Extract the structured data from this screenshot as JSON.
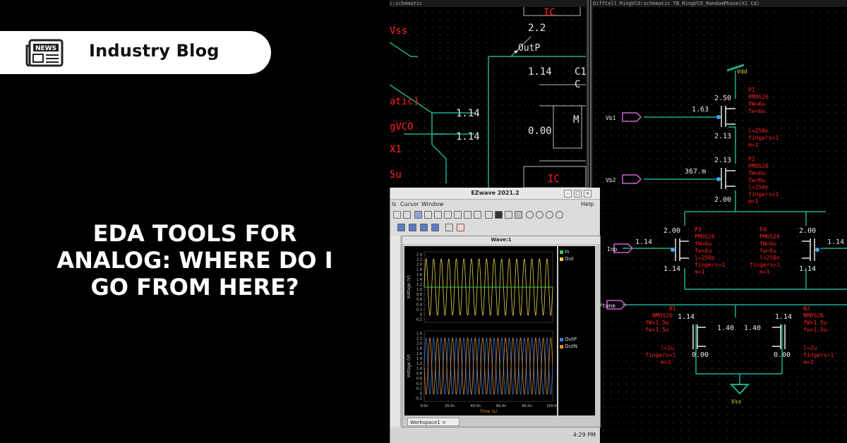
{
  "badge": {
    "label": "Industry Blog",
    "icon": "newspaper-icon",
    "icon_text": "NEWS"
  },
  "headline": {
    "lines": [
      "EDA TOOLS FOR",
      "ANALOG: WHERE DO I",
      "GO FROM HERE?"
    ]
  },
  "schematic_left": {
    "title": "c:schematic",
    "labels": [
      "IC",
      "2.2",
      "OutP",
      "1.14",
      "C1",
      "C",
      "atic)",
      "1.14",
      "gVCO",
      "1.14",
      "0.00",
      "M",
      "X1",
      "5u",
      "IC",
      "Vss"
    ]
  },
  "schematic_right": {
    "title": "DiffCell RingVCO:schematic TB_RingVCO_RandomPhase(X1 Cd)",
    "values": {
      "vdd": "Vdd",
      "vss": "Vss",
      "vb1": "Vb1",
      "vb2": "Vb2",
      "inp": "Inp",
      "vtune": "Vtune",
      "p1_top": "2.50",
      "p1_g": "1.63",
      "p1_b": "2.13",
      "p2_top": "2.13",
      "p2_g": "367.m",
      "p2_b": "2.00",
      "p3_top": "2.00",
      "p3_in": "1.14",
      "p3_b": "1.14",
      "p4_top": "2.00",
      "p4_in": "1.14",
      "p4_b": "1.14",
      "n1_d": "1.14",
      "n1_s": "0.00",
      "n2_d": "1.14",
      "n2_s": "0.00",
      "mid_l": "1.40",
      "mid_r": "1.40"
    },
    "device_notes": [
      {
        "name": "P1",
        "lines": [
          "PMOS26",
          "fW=6u",
          "fw=6u",
          "l=250n",
          "fingers=1",
          "m=1"
        ]
      },
      {
        "name": "P2",
        "lines": [
          "PMOS26",
          "fW=6u",
          "fw=6u",
          "l=250n",
          "fingers=1",
          "m=1"
        ]
      },
      {
        "name": "P3",
        "lines": [
          "PMOS26",
          "fW=6u",
          "fw=6u",
          "l=250n",
          "fingers=1",
          "m=1"
        ]
      },
      {
        "name": "P4",
        "lines": [
          "PMOS26",
          "fW=6u",
          "fw=6u",
          "l=250n",
          "fingers=1",
          "m=1"
        ]
      },
      {
        "name": "N1",
        "lines": [
          "NMOS26",
          "fW=1.5u",
          "fw=1.5u",
          "l=2u",
          "fingers=1",
          "m=1"
        ]
      },
      {
        "name": "N2",
        "lines": [
          "NMOS26",
          "fW=1.5u",
          "fw=1.5u",
          "l=2u",
          "fingers=1",
          "m=1"
        ]
      }
    ]
  },
  "ezwave": {
    "title": "EZwave 2021.2",
    "menu": {
      "file": "ls",
      "cursor": "Cursor",
      "window": "Window",
      "help": "Help"
    },
    "wave_title": "Wave:1",
    "workspace_tab": "Workspace1",
    "clock": "4:29 PM",
    "upper_plot": {
      "ylabel": "Voltage (V)",
      "yticks": [
        "2.4",
        "2.2",
        "2.0",
        "1.8",
        "1.6",
        "1.4",
        "1.2",
        "1.0",
        "0.8",
        "0.6",
        "0.4",
        "0.2",
        "0",
        "-0.2"
      ],
      "legend": [
        {
          "name": "In",
          "color": "#39d24a"
        },
        {
          "name": "Out",
          "color": "#e6d34a"
        }
      ]
    },
    "lower_plot": {
      "ylabel": "Voltage (V)",
      "yticks": [
        "2.4",
        "2.2",
        "2.0",
        "1.8",
        "1.6",
        "1.4",
        "1.2",
        "1.0",
        "0.8",
        "0.6",
        "0.4",
        "0.2",
        "0",
        "-0.2"
      ],
      "legend": [
        {
          "name": "OutP",
          "color": "#3a7ad6"
        },
        {
          "name": "OutN",
          "color": "#e08a2a"
        }
      ]
    },
    "xticks": [
      "0.0n",
      "20.0n",
      "40.0n",
      "60.0n",
      "80.0n",
      "100.0n"
    ],
    "xlabel": "Time (s)"
  },
  "colors": {
    "background": "#000000",
    "pill": "#ffffff",
    "schematic_grid": "#3a3a3a",
    "wire": "#1fae8f",
    "annotation": "#ff2020",
    "value_text": "#e8e8e8",
    "device_blue": "#4aa3ff"
  }
}
